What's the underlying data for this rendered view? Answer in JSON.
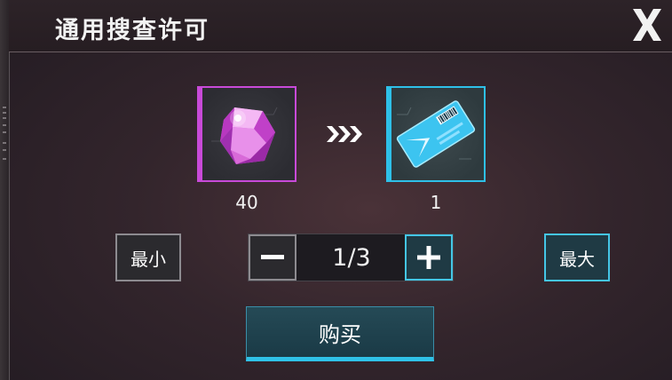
{
  "dialog": {
    "title": "通用搜查许可"
  },
  "exchange": {
    "cost": {
      "icon": "pink-crystal-icon",
      "amount": "40"
    },
    "reward": {
      "icon": "blue-ticket-icon",
      "amount": "1"
    }
  },
  "controls": {
    "min_label": "最小",
    "max_label": "最大",
    "quantity": "1/3"
  },
  "buy_label": "购买",
  "colors": {
    "pink_frame": "#c84ad8",
    "cyan_frame": "#2ec0e8",
    "accent": "#44c6e6"
  }
}
